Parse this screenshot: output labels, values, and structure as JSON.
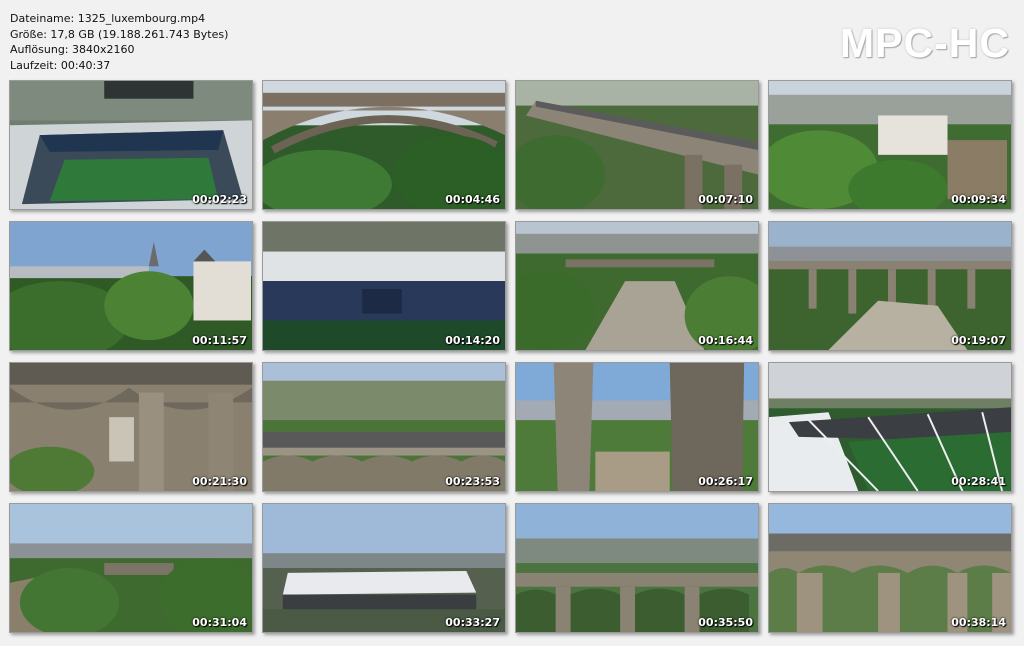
{
  "header": {
    "filename": "Dateiname: 1325_luxembourg.mp4",
    "size": "Größe: 17,8 GB (19.188.261.743 Bytes)",
    "resolution": "Auflösung: 3840x2160",
    "duration": "Laufzeit: 00:40:37"
  },
  "logo": "MPC-HC",
  "thumbnails": [
    {
      "time": "00:02:23",
      "icon": "stadium-aerial-image"
    },
    {
      "time": "00:04:46",
      "icon": "bridge-arch-image"
    },
    {
      "time": "00:07:10",
      "icon": "viaduct-road-image"
    },
    {
      "time": "00:09:34",
      "icon": "old-town-image"
    },
    {
      "time": "00:11:57",
      "icon": "cathedral-view-image"
    },
    {
      "time": "00:14:20",
      "icon": "stadium-stands-image"
    },
    {
      "time": "00:16:44",
      "icon": "city-valley-image"
    },
    {
      "time": "00:19:07",
      "icon": "viaduct-distant-image"
    },
    {
      "time": "00:21:30",
      "icon": "bridge-underside-image"
    },
    {
      "time": "00:23:53",
      "icon": "bridge-top-image"
    },
    {
      "time": "00:26:17",
      "icon": "bridge-pillars-image"
    },
    {
      "time": "00:28:41",
      "icon": "stadium-roof-image"
    },
    {
      "time": "00:31:04",
      "icon": "fortress-view-image"
    },
    {
      "time": "00:33:27",
      "icon": "arena-building-image"
    },
    {
      "time": "00:35:50",
      "icon": "viaduct-arches-image"
    },
    {
      "time": "00:38:14",
      "icon": "bridge-closeup-image"
    }
  ]
}
